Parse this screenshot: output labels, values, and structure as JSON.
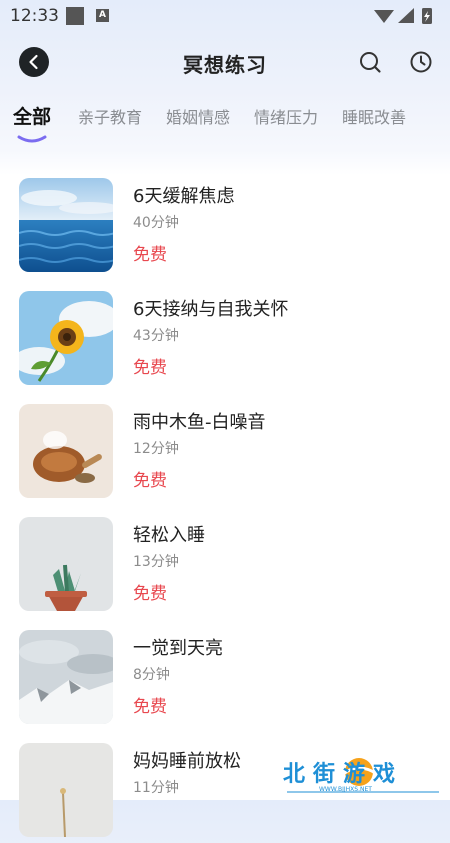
{
  "status_bar": {
    "time": "12:33",
    "a_badge": "A"
  },
  "header": {
    "title": "冥想练习"
  },
  "tabs": [
    {
      "label": "全部",
      "active": true
    },
    {
      "label": "亲子教育",
      "active": false
    },
    {
      "label": "婚姻情感",
      "active": false
    },
    {
      "label": "情绪压力",
      "active": false
    },
    {
      "label": "睡眠改善",
      "active": false
    }
  ],
  "items": [
    {
      "name": "6天缓解焦虑",
      "duration": "40分钟",
      "price": "免费"
    },
    {
      "name": "6天接纳与自我关怀",
      "duration": "43分钟",
      "price": "免费"
    },
    {
      "name": "雨中木鱼-白噪音",
      "duration": "12分钟",
      "price": "免费"
    },
    {
      "name": "轻松入睡",
      "duration": "13分钟",
      "price": "免费"
    },
    {
      "name": "一觉到天亮",
      "duration": "8分钟",
      "price": "免费"
    },
    {
      "name": "妈妈睡前放松",
      "duration": "11分钟",
      "price": ""
    }
  ],
  "watermark": {
    "text": "北街游戏",
    "sub": "WWW.BJJHXS.NET"
  },
  "colors": {
    "price": "#e8484f",
    "tab_indicator": "#7b6cf0",
    "back_button": "#1f2326"
  },
  "icons": [
    "back-arrow-icon",
    "search-icon",
    "history-clock-icon"
  ]
}
